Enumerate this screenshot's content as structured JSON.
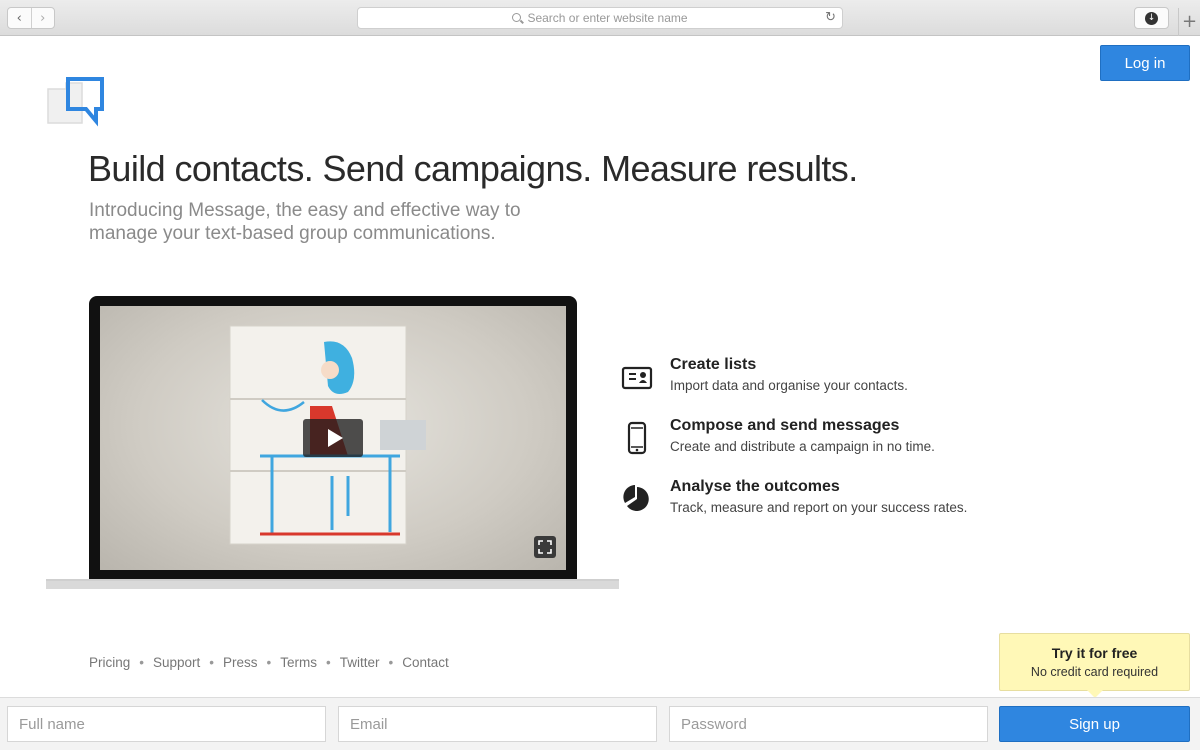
{
  "browser": {
    "back_icon": "chevron-left-icon",
    "forward_icon": "chevron-right-icon",
    "url_placeholder": "Search or enter website name",
    "reload_icon": "reload-icon",
    "download_icon": "download-icon",
    "new_tab_icon": "plus-icon"
  },
  "header": {
    "login_label": "Log in",
    "logo_icon": "speech-bubble-logo-icon",
    "accent_color": "#2f86e0"
  },
  "hero": {
    "headline": "Build contacts. Send campaigns. Measure results.",
    "intro": "Introducing Message, the easy and effective way to manage your text-based group communications."
  },
  "video": {
    "play_icon": "play-icon",
    "fullscreen_icon": "fullscreen-icon"
  },
  "features": [
    {
      "icon": "contact-card-icon",
      "title": "Create lists",
      "description": "Import data and organise your contacts."
    },
    {
      "icon": "phone-icon",
      "title": "Compose and send messages",
      "description": "Create and distribute a campaign in no time."
    },
    {
      "icon": "pie-chart-icon",
      "title": "Analyse the outcomes",
      "description": "Track, measure and report on your success rates."
    }
  ],
  "footer": {
    "links": [
      "Pricing",
      "Support",
      "Press",
      "Terms",
      "Twitter",
      "Contact"
    ],
    "separator": "•"
  },
  "tooltip": {
    "title": "Try it for free",
    "subtitle": "No credit card required"
  },
  "signup": {
    "full_name_placeholder": "Full name",
    "email_placeholder": "Email",
    "password_placeholder": "Password",
    "button_label": "Sign up"
  }
}
